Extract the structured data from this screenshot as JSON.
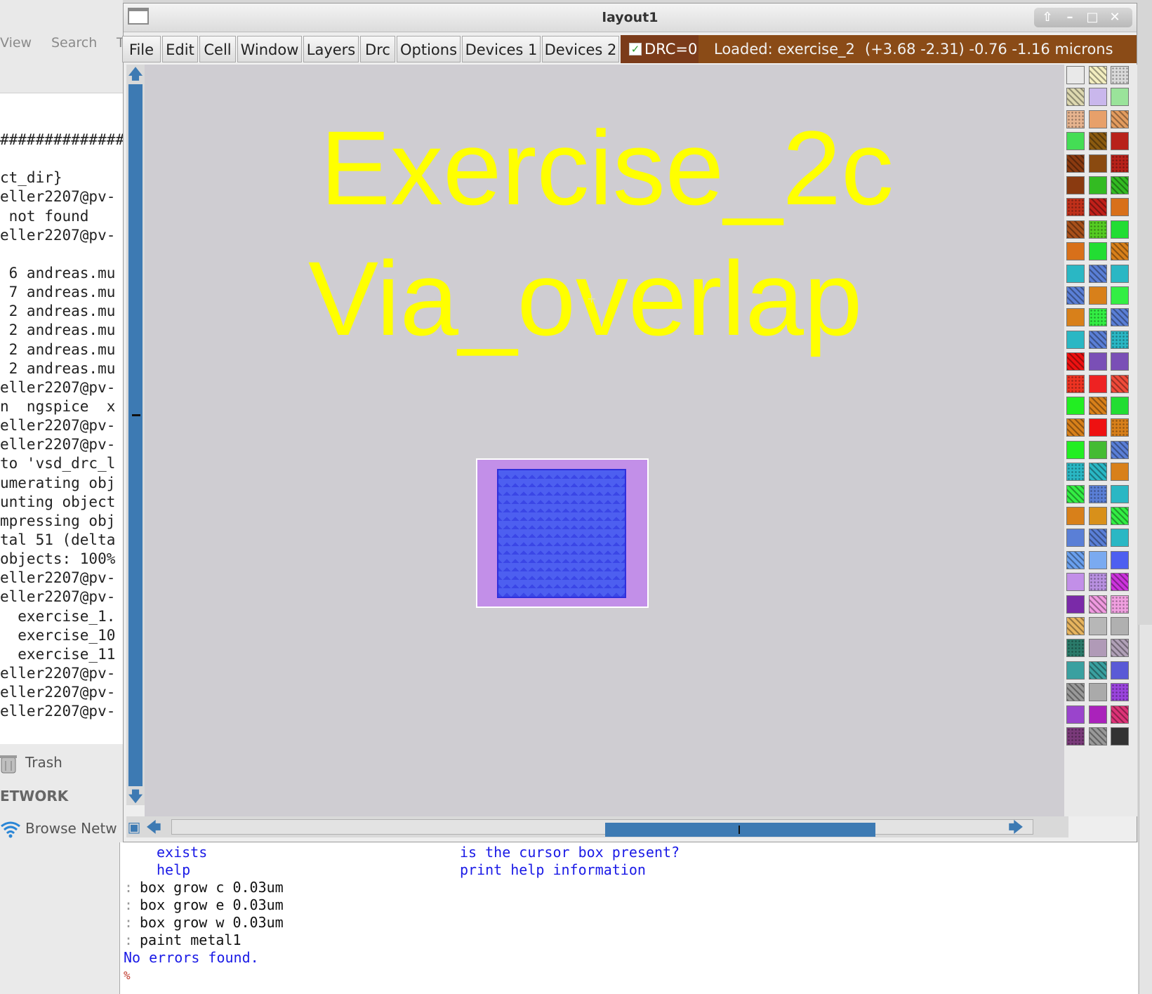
{
  "background_app": {
    "menu": [
      "View",
      "Search",
      "T"
    ],
    "terminal_lines": [
      "##############",
      "",
      "ct_dir}",
      "eller2207@pv-",
      " not found",
      "eller2207@pv-",
      "",
      " 6 andreas.mu",
      " 7 andreas.mu",
      " 2 andreas.mu",
      " 2 andreas.mu",
      " 2 andreas.mu",
      " 2 andreas.mu",
      "eller2207@pv-",
      "n  ngspice  x",
      "eller2207@pv-",
      "eller2207@pv-",
      "to 'vsd_drc_l",
      "umerating obj",
      "unting object",
      "mpressing obj",
      "tal 51 (delta",
      "objects: 100%",
      "eller2207@pv-",
      "eller2207@pv-",
      "  exercise_1.",
      "  exercise_10",
      "  exercise_11",
      "eller2207@pv-",
      "eller2207@pv-",
      "eller2207@pv-"
    ],
    "sidebar": {
      "trash": "Trash",
      "network_heading": "ETWORK",
      "browse_network": "Browse Netw"
    }
  },
  "window": {
    "title": "layout1",
    "controls": [
      "up-icon",
      "minimize-icon",
      "maximize-icon",
      "close-icon"
    ]
  },
  "menubar": {
    "items": [
      "File",
      "Edit",
      "Cell",
      "Window",
      "Layers",
      "Drc",
      "Options",
      "Devices 1",
      "Devices 2"
    ],
    "drc_label": "DRC=0",
    "status_loaded": "Loaded: exercise_2 l",
    "status_coords": "(+3.68 -2.31) -0.76 -1.16 microns"
  },
  "canvas": {
    "label_line1": "Exercise_2c",
    "label_line2": "Via_overlap",
    "background_color": "#cfcdd2",
    "label_color": "#ffff00",
    "metal_color": "#c28fe8",
    "via_color": "#4d5ff0"
  },
  "palette": {
    "rows": [
      [
        "#e9e9e9",
        "#f3eec0",
        "#d9d9d9"
      ],
      [
        "#ddd8b0",
        "#c9b7ec",
        "#9ae39a"
      ],
      [
        "#e7b48f",
        "#e7a06a",
        "#e39c5f"
      ],
      [
        "#44dd55",
        "#8a5a10",
        "#b8221a"
      ],
      [
        "#8a3a10",
        "#8a4a10",
        "#b8221a"
      ],
      [
        "#8a3a10",
        "#33bb22",
        "#33bb22"
      ],
      [
        "#c0301a",
        "#c0201a",
        "#d8701a"
      ],
      [
        "#a8501a",
        "#55cc22",
        "#22dd33"
      ],
      [
        "#d8701a",
        "#22dd33",
        "#d8801a"
      ],
      [
        "#2ab7c4",
        "#5a7fd6",
        "#2ab7c4"
      ],
      [
        "#5a7fd6",
        "#d8801a",
        "#33ee44"
      ],
      [
        "#d8801a",
        "#33ee44",
        "#5a7fd6"
      ],
      [
        "#2ab7c4",
        "#5a7fd6",
        "#2ab7c4"
      ],
      [
        "#ee1111",
        "#7a4fb6",
        "#7a4fb6"
      ],
      [
        "#ee3322",
        "#ee2222",
        "#f04a3a"
      ],
      [
        "#22ee22",
        "#d8801a",
        "#22dd33"
      ],
      [
        "#d8801a",
        "#ee1111",
        "#d8801a"
      ],
      [
        "#22ee22",
        "#44bb33",
        "#5a7fd6"
      ],
      [
        "#2ab7c4",
        "#2ab7c4",
        "#d8801a"
      ],
      [
        "#33ee44",
        "#5a7fd6",
        "#2ab7c4"
      ],
      [
        "#d8801a",
        "#d8901a",
        "#33ee44"
      ],
      [
        "#5a7fd6",
        "#5a7fd6",
        "#2ab7c4"
      ],
      [
        "#6aa0ee",
        "#7aaaf0",
        "#4d5ff0"
      ],
      [
        "#c28fe8",
        "#b890e0",
        "#cc33dd"
      ],
      [
        "#7a2aa8",
        "#f09ae0",
        "#f0a0e0"
      ],
      [
        "#e7b45f",
        "#b7b7b7",
        "#b0b0b0"
      ],
      [
        "#2a7a6a",
        "#b09ab7",
        "#b0a0b7"
      ],
      [
        "#3aa0a0",
        "#3aa0a0",
        "#5a5ad6"
      ],
      [
        "#999999",
        "#aaaaaa",
        "#9a44dd"
      ],
      [
        "#9a44cc",
        "#aa22bb",
        "#dd3377"
      ],
      [
        "#7a3a7a",
        "#999999",
        "#333333"
      ]
    ]
  },
  "console": {
    "help_rows": [
      {
        "cmd": "exists",
        "desc": "is the cursor box present?"
      },
      {
        "cmd": "help",
        "desc": "print help information"
      }
    ],
    "commands": [
      "box grow c 0.03um",
      "box grow e 0.03um",
      "box grow w 0.03um",
      "paint metal1"
    ],
    "result": "No errors found.",
    "prompt": "%"
  }
}
